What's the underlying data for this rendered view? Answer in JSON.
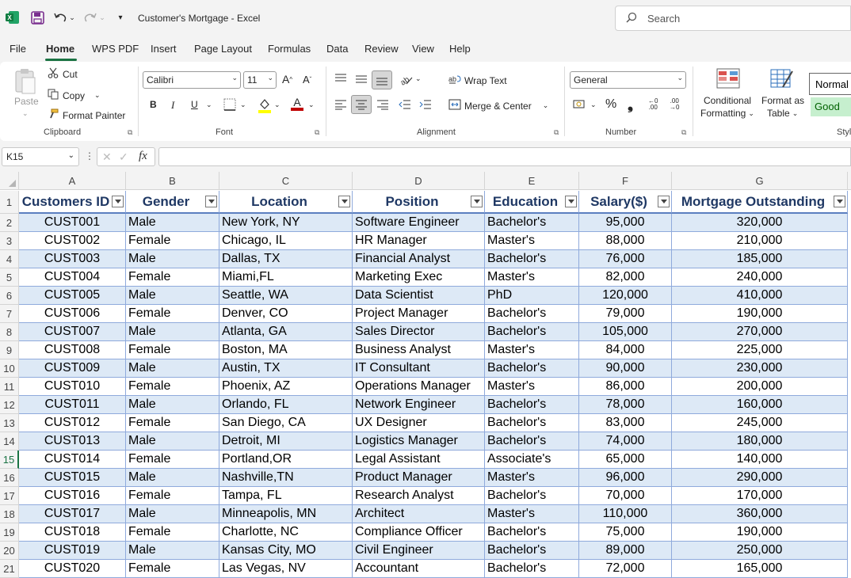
{
  "titlebar": {
    "title": "Customer's Mortgage  -  Excel",
    "search_placeholder": "Search"
  },
  "menu": [
    "File",
    "Home",
    "WPS PDF",
    "Insert",
    "Page Layout",
    "Formulas",
    "Data",
    "Review",
    "View",
    "Help"
  ],
  "ribbon": {
    "clipboard": {
      "paste": "Paste",
      "cut": "Cut",
      "copy": "Copy",
      "format_painter": "Format Painter",
      "label": "Clipboard"
    },
    "font": {
      "name": "Calibri",
      "size": "11",
      "bold": "B",
      "italic": "I",
      "underline": "U",
      "label": "Font"
    },
    "alignment": {
      "wrap_text": "Wrap Text",
      "merge_center": "Merge & Center",
      "label": "Alignment"
    },
    "number": {
      "format": "General",
      "percent": "%",
      "comma": "❟",
      "label": "Number"
    },
    "styles": {
      "conditional": "Conditional",
      "formatting": "Formatting",
      "format_as": "Format as",
      "table": "Table",
      "normal": "Normal",
      "good": "Good",
      "label": "Styl"
    }
  },
  "formula_bar": {
    "name_box": "K15",
    "fx": "fx",
    "value": ""
  },
  "columns": [
    "A",
    "B",
    "C",
    "D",
    "E",
    "F",
    "G"
  ],
  "table": {
    "headers": [
      "Customers ID",
      "Gender",
      "Location",
      "Position",
      "Education",
      "Salary($)",
      "Mortgage Outstanding"
    ],
    "rows": [
      [
        "CUST001",
        "Male",
        "New York, NY",
        "Software Engineer",
        "Bachelor's",
        "95,000",
        "320,000"
      ],
      [
        "CUST002",
        "Female",
        "Chicago, IL",
        "HR Manager",
        "Master's",
        "88,000",
        "210,000"
      ],
      [
        "CUST003",
        "Male",
        "Dallas, TX",
        "Financial Analyst",
        "Bachelor's",
        "76,000",
        "185,000"
      ],
      [
        "CUST004",
        "Female",
        "Miami,FL",
        "Marketing Exec",
        "Master's",
        "82,000",
        "240,000"
      ],
      [
        "CUST005",
        "Male",
        "Seattle, WA",
        "Data Scientist",
        "PhD",
        "120,000",
        "410,000"
      ],
      [
        "CUST006",
        "Female",
        "Denver, CO",
        "Project Manager",
        "Bachelor's",
        "79,000",
        "190,000"
      ],
      [
        "CUST007",
        "Male",
        "Atlanta, GA",
        "Sales Director",
        "Bachelor's",
        "105,000",
        "270,000"
      ],
      [
        "CUST008",
        "Female",
        "Boston, MA",
        "Business Analyst",
        "Master's",
        "84,000",
        "225,000"
      ],
      [
        "CUST009",
        "Male",
        "Austin, TX",
        "IT Consultant",
        "Bachelor's",
        "90,000",
        "230,000"
      ],
      [
        "CUST010",
        "Female",
        "Phoenix, AZ",
        "Operations Manager",
        "Master's",
        "86,000",
        "200,000"
      ],
      [
        "CUST011",
        "Male",
        "Orlando, FL",
        "Network Engineer",
        "Bachelor's",
        "78,000",
        "160,000"
      ],
      [
        "CUST012",
        "Female",
        "San Diego, CA",
        "UX Designer",
        "Bachelor's",
        "83,000",
        "245,000"
      ],
      [
        "CUST013",
        "Male",
        "Detroit, MI",
        "Logistics Manager",
        "Bachelor's",
        "74,000",
        "180,000"
      ],
      [
        "CUST014",
        "Female",
        "Portland,OR",
        "Legal Assistant",
        "Associate's",
        "65,000",
        "140,000"
      ],
      [
        "CUST015",
        "Male",
        "Nashville,TN",
        "Product Manager",
        "Master's",
        "96,000",
        "290,000"
      ],
      [
        "CUST016",
        "Female",
        "Tampa, FL",
        "Research Analyst",
        "Bachelor's",
        "70,000",
        "170,000"
      ],
      [
        "CUST017",
        "Male",
        "Minneapolis, MN",
        "Architect",
        "Master's",
        "110,000",
        "360,000"
      ],
      [
        "CUST018",
        "Female",
        "Charlotte, NC",
        "Compliance Officer",
        "Bachelor's",
        "75,000",
        "190,000"
      ],
      [
        "CUST019",
        "Male",
        "Kansas City, MO",
        "Civil Engineer",
        "Bachelor's",
        "89,000",
        "250,000"
      ],
      [
        "CUST020",
        "Female",
        "Las Vegas, NV",
        "Accountant",
        "Bachelor's",
        "72,000",
        "165,000"
      ]
    ]
  },
  "selected_row": 15
}
